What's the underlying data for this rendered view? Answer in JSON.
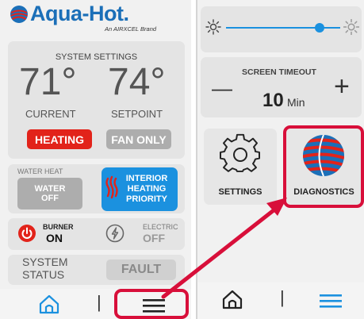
{
  "colors": {
    "accent_blue": "#1b91df",
    "heating_red": "#e2231a",
    "highlight_red": "#d80f3a",
    "button_grey": "#adadad",
    "text_grey": "#555555"
  },
  "left_screen": {
    "logo": {
      "brand": "Aqua-Hot.",
      "tagline": "An AIRXCEL Brand"
    },
    "system_settings": {
      "title": "SYSTEM SETTINGS",
      "current_temp": "71°",
      "current_label": "CURRENT",
      "setpoint_temp": "74°",
      "setpoint_label": "SETPOINT",
      "heating_label": "HEATING",
      "fan_only_label": "FAN ONLY"
    },
    "water_heat": {
      "title": "WATER HEAT",
      "water_line1": "WATER",
      "water_line2": "OFF",
      "interior_line1": "INTERIOR",
      "interior_line2": "HEATING",
      "interior_line3": "PRIORITY"
    },
    "burner": {
      "label": "BURNER",
      "value": "ON",
      "icon": "power-icon"
    },
    "electric": {
      "label": "ELECTRIC",
      "value": "OFF",
      "icon": "lightning-icon"
    },
    "system_status": {
      "line1": "SYSTEM",
      "line2": "STATUS",
      "value": "FAULT"
    },
    "nav": {
      "home_icon": "home-icon",
      "menu_icon": "menu-icon",
      "separator": "|"
    }
  },
  "right_screen": {
    "brightness": {
      "level": 0.82,
      "low_icon": "sun-small-icon",
      "high_icon": "sun-large-icon"
    },
    "screen_timeout": {
      "title": "SCREEN TIMEOUT",
      "value": "10",
      "unit": "Min",
      "minus": "—",
      "plus": "+"
    },
    "settings": {
      "label": "SETTINGS",
      "icon": "gear-icon"
    },
    "diagnostics": {
      "label": "DIAGNOSTICS",
      "icon": "globe-icon"
    },
    "nav": {
      "home_icon": "home-icon",
      "menu_icon": "menu-icon",
      "separator": "|"
    }
  }
}
